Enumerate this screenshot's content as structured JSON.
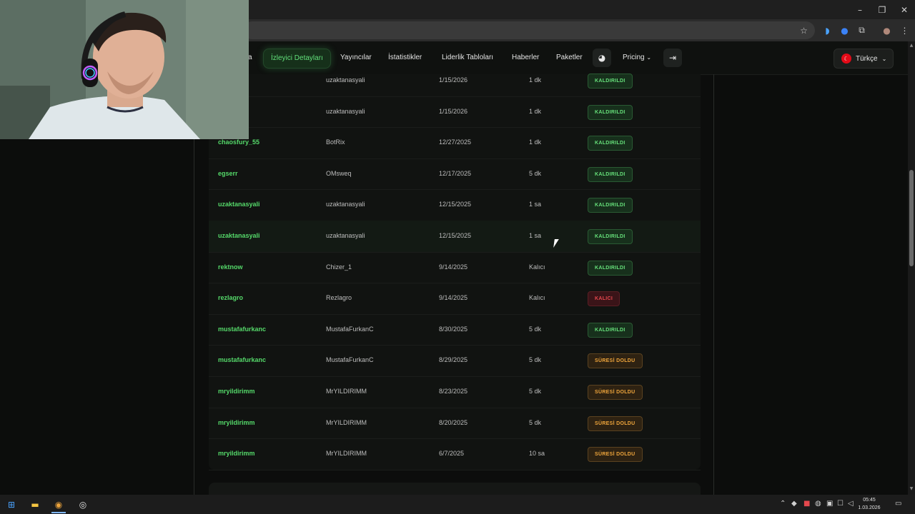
{
  "nav": {
    "partial_item": "a",
    "items": [
      "İzleyici Detayları",
      "Yayıncılar",
      "İstatistikler",
      "Liderlik Tabloları",
      "Haberler",
      "Paketler"
    ],
    "pricing": "Pricing",
    "language": "Türkçe"
  },
  "table": {
    "rows": [
      {
        "user": "uzaktanasyali",
        "user_visible": "yali",
        "channel": "uzaktanasyali",
        "date": "1/15/2026",
        "duration": "1 dk",
        "status": "KALDIRILDI",
        "kind": "removed"
      },
      {
        "user": "uzaktanasyali",
        "user_visible": "yali",
        "channel": "uzaktanasyali",
        "date": "1/15/2026",
        "duration": "1 dk",
        "status": "KALDIRILDI",
        "kind": "removed"
      },
      {
        "user": "chaosfury_55",
        "user_visible": "chaosfury_55",
        "channel": "BotRix",
        "date": "12/27/2025",
        "duration": "1 dk",
        "status": "KALDIRILDI",
        "kind": "removed"
      },
      {
        "user": "egserr",
        "user_visible": "egserr",
        "channel": "OMsweq",
        "date": "12/17/2025",
        "duration": "5 dk",
        "status": "KALDIRILDI",
        "kind": "removed"
      },
      {
        "user": "uzaktanasyali",
        "user_visible": "uzaktanasyali",
        "channel": "uzaktanasyali",
        "date": "12/15/2025",
        "duration": "1 sa",
        "status": "KALDIRILDI",
        "kind": "removed"
      },
      {
        "user": "uzaktanasyali",
        "user_visible": "uzaktanasyali",
        "channel": "uzaktanasyali",
        "date": "12/15/2025",
        "duration": "1 sa",
        "status": "KALDIRILDI",
        "kind": "removed"
      },
      {
        "user": "rektnow",
        "user_visible": "rektnow",
        "channel": "Chizer_1",
        "date": "9/14/2025",
        "duration": "Kalıcı",
        "status": "KALDIRILDI",
        "kind": "removed"
      },
      {
        "user": "rezlagro",
        "user_visible": "rezlagro",
        "channel": "Rezlagro",
        "date": "9/14/2025",
        "duration": "Kalıcı",
        "status": "KALICI",
        "kind": "perm"
      },
      {
        "user": "mustafafurkanc",
        "user_visible": "mustafafurkanc",
        "channel": "MustafaFurkanC",
        "date": "8/30/2025",
        "duration": "5 dk",
        "status": "KALDIRILDI",
        "kind": "removed"
      },
      {
        "user": "mustafafurkanc",
        "user_visible": "mustafafurkanc",
        "channel": "MustafaFurkanC",
        "date": "8/29/2025",
        "duration": "5 dk",
        "status": "SÜRESİ DOLDU",
        "kind": "expired"
      },
      {
        "user": "mryildirimm",
        "user_visible": "mryildirimm",
        "channel": "MrYILDIRIMM",
        "date": "8/23/2025",
        "duration": "5 dk",
        "status": "SÜRESİ DOLDU",
        "kind": "expired"
      },
      {
        "user": "mryildirimm",
        "user_visible": "mryildirimm",
        "channel": "MrYILDIRIMM",
        "date": "8/20/2025",
        "duration": "5 dk",
        "status": "SÜRESİ DOLDU",
        "kind": "expired"
      },
      {
        "user": "mryildirimm",
        "user_visible": "mryildirimm",
        "channel": "MrYILDIRIMM",
        "date": "6/7/2025",
        "duration": "10 sa",
        "status": "SÜRESİ DOLDU",
        "kind": "expired"
      }
    ]
  },
  "taskbar": {
    "time": "05:45",
    "date": "1.03.2026"
  },
  "colors": {
    "accent_green": "#55d96a",
    "perm_red": "#e5484d",
    "expired_orange": "#f0a63c"
  },
  "icons": [
    "star-icon",
    "extensions-icon",
    "menu-dots-icon",
    "discord-icon",
    "login-icon",
    "windows-start-icon",
    "file-explorer-icon",
    "chrome-icon",
    "obs-icon",
    "notification-icon"
  ]
}
